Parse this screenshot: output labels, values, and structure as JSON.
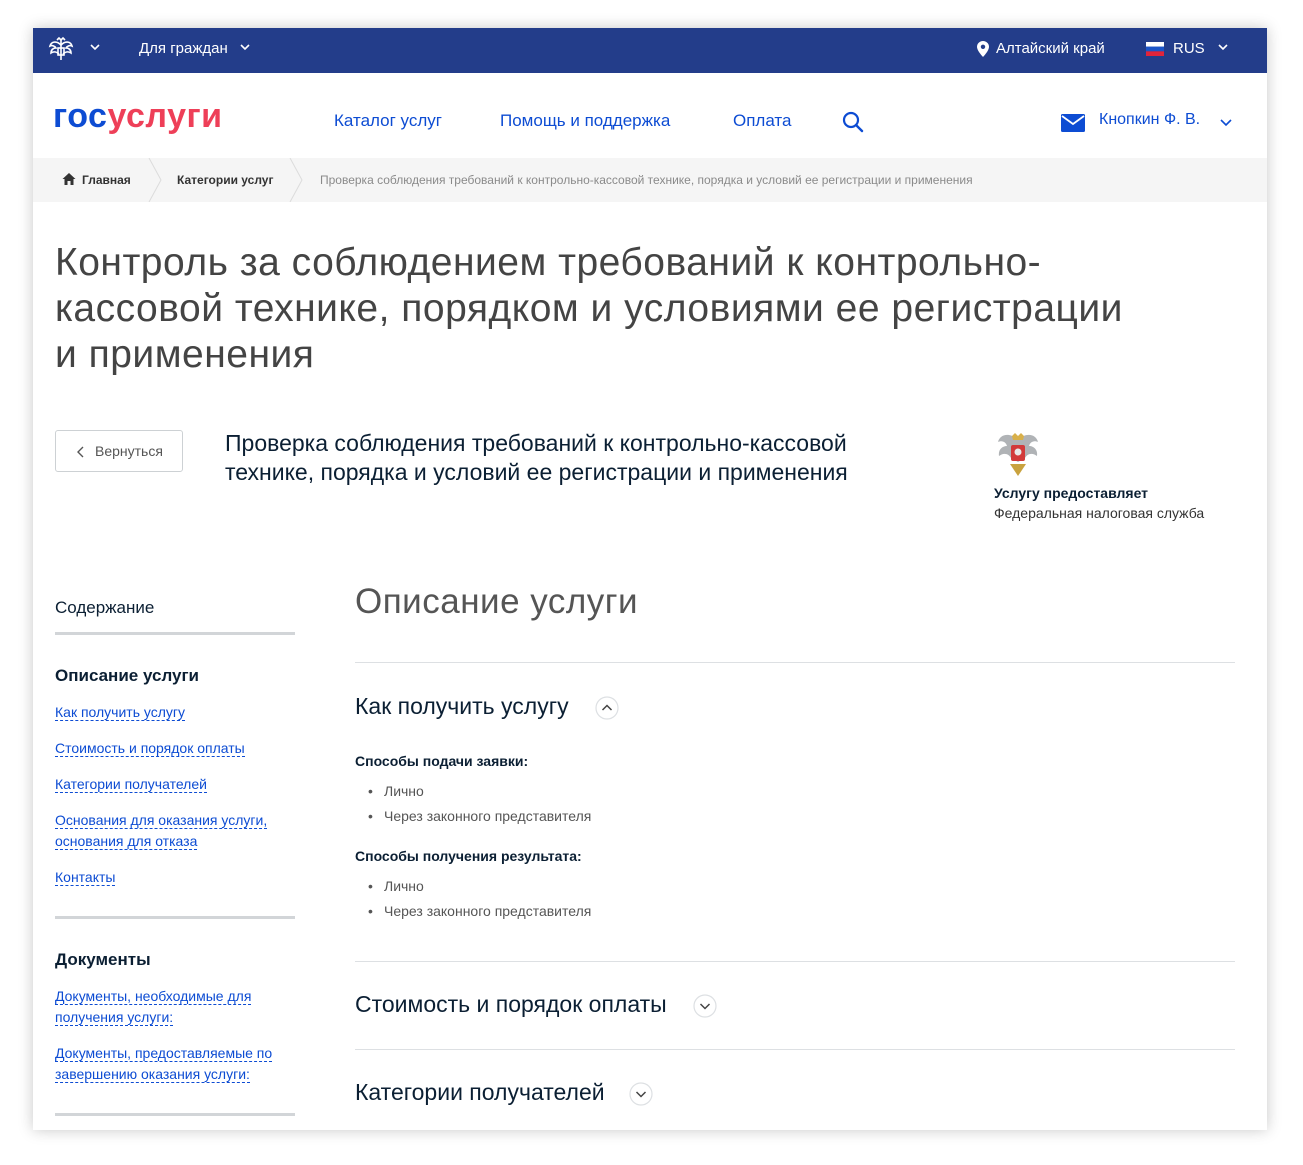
{
  "topbar": {
    "for_citizens": "Для граждан",
    "region": "Алтайский край",
    "language": "RUS"
  },
  "header": {
    "logo_part1": "гос",
    "logo_part2": "услуги",
    "nav": [
      "Каталог услуг",
      "Помощь и поддержка",
      "Оплата"
    ],
    "user_name": "Кнопкин Ф. В."
  },
  "breadcrumb": {
    "home": "Главная",
    "category": "Категории услуг",
    "current": "Проверка соблюдения требований к контрольно-кассовой технике, порядка и условий ее регистрации и применения"
  },
  "page_title": "Контроль за соблюдением требований к контрольно-кассовой технике, порядком и условиями ее регистрации и применения",
  "back_label": "Вернуться",
  "service_title": "Проверка соблюдения требований к контрольно-кассовой технике, порядка и условий ее регистрации и применения",
  "provider": {
    "label": "Услугу предоставляет",
    "name": "Федеральная налоговая служба"
  },
  "sidebar": {
    "toc_title": "Содержание",
    "section1_title": "Описание услуги",
    "section1_links": [
      "Как получить услугу",
      "Стоимость и порядок оплаты",
      "Категории получателей",
      "Основания для оказания услуги, основания для отказа",
      "Контакты"
    ],
    "section2_title": "Документы",
    "section2_links": [
      "Документы, необходимые для получения услуги:",
      "Документы, предоставляемые по завершению оказания услуги:"
    ]
  },
  "main": {
    "section_title": "Описание услуги",
    "accordions": [
      {
        "title": "Как получить услугу",
        "expanded": true,
        "groups": [
          {
            "heading": "Способы подачи заявки:",
            "items": [
              "Лично",
              "Через законного представителя"
            ]
          },
          {
            "heading": "Способы получения результата:",
            "items": [
              "Лично",
              "Через законного представителя"
            ]
          }
        ]
      },
      {
        "title": "Стоимость и порядок оплаты",
        "expanded": false
      },
      {
        "title": "Категории получателей",
        "expanded": false
      }
    ]
  },
  "colors": {
    "topbar_bg": "#233d8a",
    "link_blue": "#0d4cd3",
    "logo_red": "#ee3f58",
    "breadcrumb_bg": "#f5f5f5"
  },
  "icons": [
    "emblem-icon",
    "chevron-down-icon",
    "location-pin-icon",
    "flag-icon",
    "search-icon",
    "mail-icon",
    "home-icon",
    "chevron-left-icon",
    "chevron-up-icon"
  ]
}
